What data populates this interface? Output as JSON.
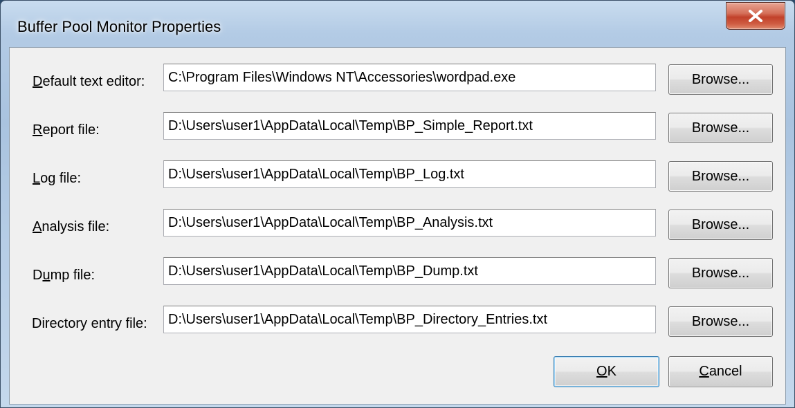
{
  "window": {
    "title": "Buffer Pool Monitor Properties"
  },
  "rows": [
    {
      "label_ul": "D",
      "label_rest": "efault text editor:",
      "value": "C:\\Program Files\\Windows NT\\Accessories\\wordpad.exe",
      "browse_label": "Browse..."
    },
    {
      "label_ul": "R",
      "label_rest": "eport file:",
      "value": "D:\\Users\\user1\\AppData\\Local\\Temp\\BP_Simple_Report.txt",
      "browse_label": "Browse..."
    },
    {
      "label_ul": "L",
      "label_rest": "og file:",
      "value": "D:\\Users\\user1\\AppData\\Local\\Temp\\BP_Log.txt",
      "browse_label": "Browse..."
    },
    {
      "label_ul": "A",
      "label_rest": "nalysis file:",
      "value": "D:\\Users\\user1\\AppData\\Local\\Temp\\BP_Analysis.txt",
      "browse_label": "Browse..."
    },
    {
      "label_pre": "D",
      "label_ul": "u",
      "label_rest": "mp file:",
      "value": "D:\\Users\\user1\\AppData\\Local\\Temp\\BP_Dump.txt",
      "browse_label": "Browse..."
    },
    {
      "label_pre": "Directory entry file:",
      "value": "D:\\Users\\user1\\AppData\\Local\\Temp\\BP_Directory_Entries.txt",
      "browse_label": "Browse..."
    }
  ],
  "buttons": {
    "ok_ul": "O",
    "ok_rest": "K",
    "cancel_ul": "C",
    "cancel_rest": "ancel"
  },
  "colors": {
    "close_button": "#c1412a",
    "dialog_background": "#f0f0f0"
  },
  "icons": {
    "close": "close-icon"
  }
}
